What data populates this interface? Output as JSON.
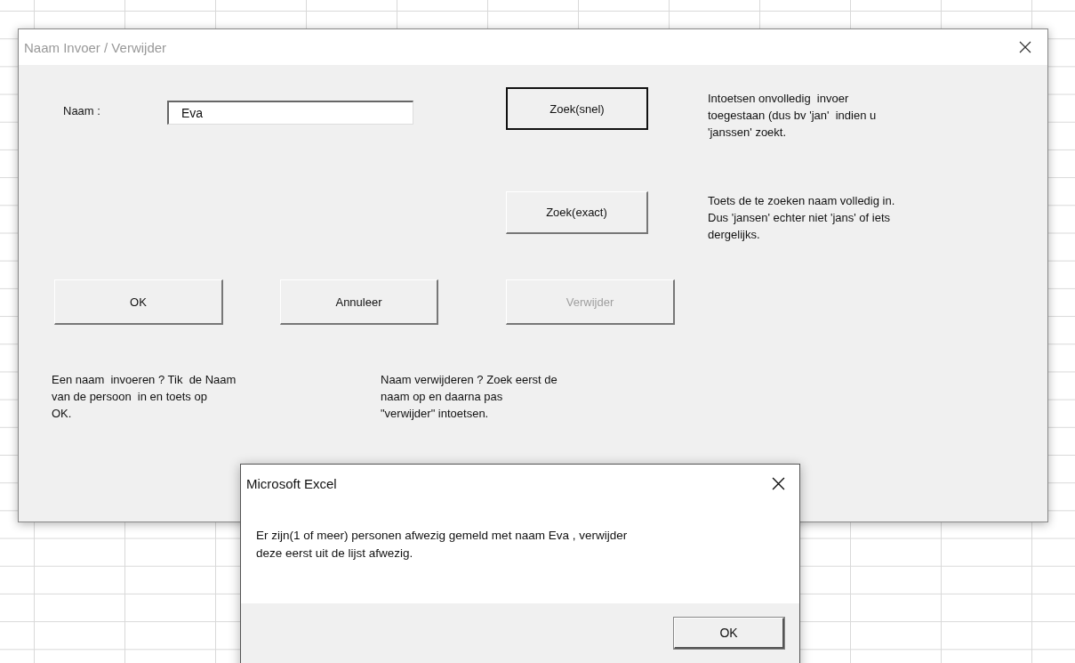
{
  "form": {
    "title": "Naam  Invoer / Verwijder",
    "active": false,
    "name_label": "Naam  :",
    "name_field": {
      "value": "Eva"
    },
    "buttons": [
      {
        "label": "Zoek(snel)",
        "default": true,
        "disabled": false
      },
      {
        "label": "Zoek(exact)",
        "default": false,
        "disabled": false
      },
      {
        "label": "OK",
        "default": false,
        "disabled": false
      },
      {
        "label": "Annuleer",
        "default": false,
        "disabled": false
      },
      {
        "label": "Verwijder",
        "default": false,
        "disabled": true
      }
    ],
    "notes": [
      "Intoetsen onvolledig  invoer\ntoegestaan (dus bv 'jan'  indien u\n'janssen' zoekt.",
      "Toets de te zoeken naam volledig in.\nDus 'jansen' echter niet 'jans' of iets\ndergelijks.",
      "Een naam  invoeren ? Tik  de Naam\nvan de persoon  in en toets op\nOK.",
      "Naam verwijderen ? Zoek eerst de\nnaam op en daarna pas\n\"verwijder\" intoetsen."
    ]
  },
  "message_box": {
    "title": "Microsoft Excel",
    "active": true,
    "message": "Er zijn(1 of meer) personen afwezig gemeld met naam Eva , verwijder\ndeze eerst uit de lijst afwezig.",
    "button": "OK"
  }
}
